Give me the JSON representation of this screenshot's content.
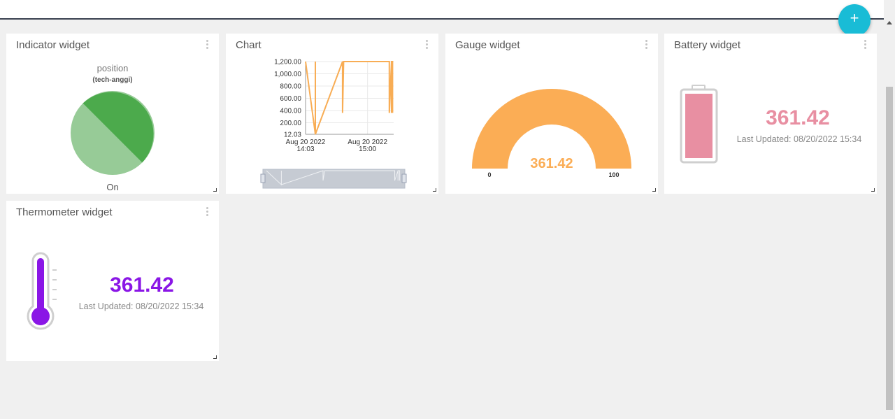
{
  "colors": {
    "accent": "#19bcd6",
    "pie_dark": "#4caa4c",
    "pie_light": "#97cb97",
    "chart_line": "#f8ad55",
    "gauge": "#fbad55",
    "battery": "#e88fa2",
    "thermometer": "#8a16e6"
  },
  "fab": {
    "icon": "plus-icon",
    "glyph": "+"
  },
  "widgets": {
    "indicator": {
      "title": "Indicator widget",
      "label": "position",
      "device": "(tech-anggi)",
      "state": "On"
    },
    "chart": {
      "title": "Chart"
    },
    "gauge": {
      "title": "Gauge widget",
      "value": "361.42",
      "min": "0",
      "max": "100",
      "fill_fraction": 1.0
    },
    "battery": {
      "title": "Battery widget",
      "value": "361.42",
      "updated": "Last Updated: 08/20/2022 15:34",
      "fill_fraction": 1.0
    },
    "thermometer": {
      "title": "Thermometer widget",
      "value": "361.42",
      "updated": "Last Updated: 08/20/2022 15:34",
      "fill_fraction": 1.0
    }
  },
  "chart_data": {
    "type": "line",
    "title": "",
    "yticks": [
      "1,200.00",
      "1,000.00",
      "800.00",
      "600.00",
      "400.00",
      "200.00",
      "12.03"
    ],
    "xticks": [
      {
        "date": "Aug 20 2022",
        "time": "14:03"
      },
      {
        "date": "Aug 20 2022",
        "time": "15:00"
      }
    ],
    "ylim": [
      12.03,
      1200
    ],
    "xlim": [
      "2022-08-20 14:03",
      "2022-08-20 15:24"
    ],
    "grid": true,
    "series": [
      {
        "x": [
          "2022-08-20 14:03",
          "2022-08-20 14:03",
          "2022-08-20 14:12",
          "2022-08-20 14:12",
          "2022-08-20 14:12",
          "2022-08-20 14:37",
          "2022-08-20 14:37",
          "2022-08-20 14:38",
          "2022-08-20 15:20",
          "2022-08-20 15:20",
          "2022-08-20 15:20",
          "2022-08-20 15:22",
          "2022-08-20 15:22",
          "2022-08-20 15:22",
          "2022-08-20 15:23",
          "2022-08-20 15:23"
        ],
        "y": [
          1200,
          1200,
          12.03,
          1200,
          12.03,
          1200,
          361.42,
          1200,
          1200,
          1200,
          361.42,
          1200,
          361.42,
          1200,
          1200,
          361.42
        ]
      }
    ]
  }
}
